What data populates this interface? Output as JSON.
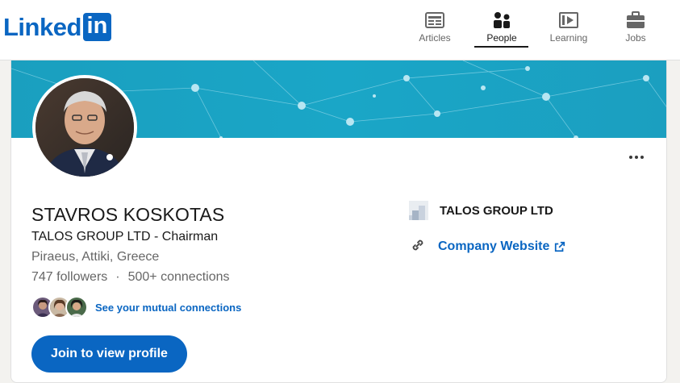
{
  "brand": {
    "logo_text": "Linked",
    "logo_box_text": "in",
    "color": "#0a66c2"
  },
  "nav": [
    {
      "label": "Articles",
      "icon": "articles-icon",
      "active": false
    },
    {
      "label": "People",
      "icon": "people-icon",
      "active": true
    },
    {
      "label": "Learning",
      "icon": "learning-icon",
      "active": false
    },
    {
      "label": "Jobs",
      "icon": "briefcase-icon",
      "active": false
    }
  ],
  "profile": {
    "name": "STAVROS KOSKOTAS",
    "headline": "TALOS GROUP LTD - Chairman",
    "location": "Piraeus, Attiki, Greece",
    "followers": "747 followers",
    "separator": "·",
    "connections": "500+ connections",
    "mutual_link": "See your mutual connections",
    "join_button": "Join to view profile"
  },
  "sidebar": {
    "company_name": "TALOS GROUP LTD",
    "website_label": "Company Website"
  }
}
